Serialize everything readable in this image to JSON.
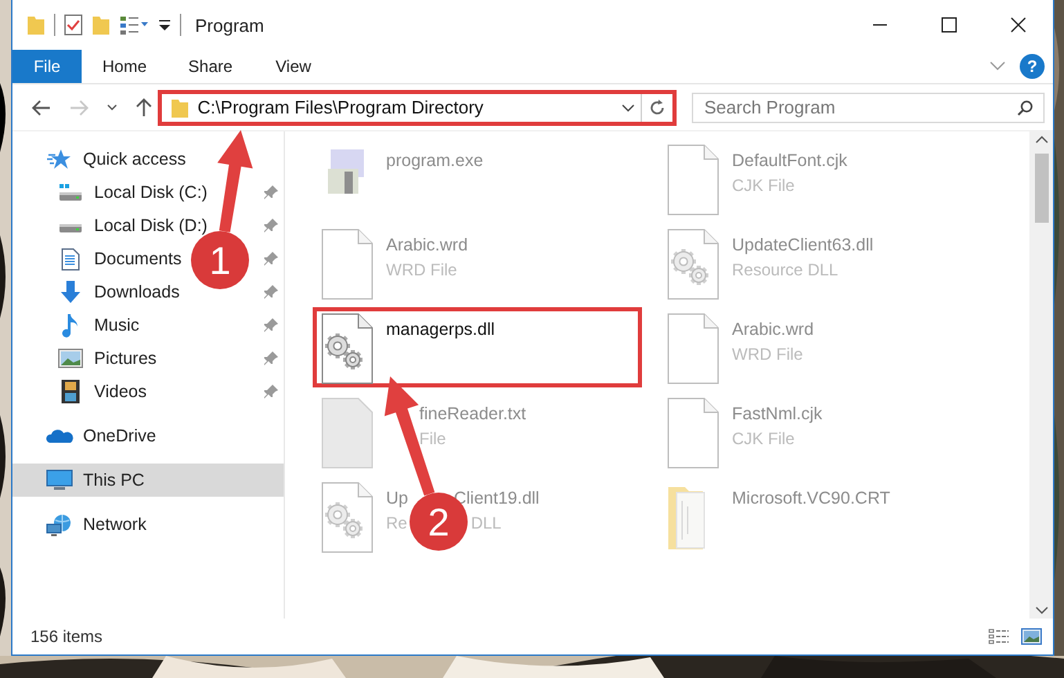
{
  "window": {
    "title": "Program"
  },
  "ribbon_tabs": [
    {
      "label": "File",
      "selected": true
    },
    {
      "label": "Home",
      "selected": false
    },
    {
      "label": "Share",
      "selected": false
    },
    {
      "label": "View",
      "selected": false
    }
  ],
  "help_button": {
    "label": "?"
  },
  "address": {
    "path": "C:\\Program Files\\Program Directory",
    "highlighted": true
  },
  "search": {
    "placeholder": "Search Program"
  },
  "sidebar": {
    "items": [
      {
        "label": "Quick access",
        "kind": "star",
        "selected": false,
        "children": [
          {
            "label": "Local Disk (C:)",
            "kind": "system-drive",
            "pinned": true,
            "selected": false
          },
          {
            "label": "Local Disk (D:)",
            "kind": "drive",
            "pinned": true,
            "selected": false
          },
          {
            "label": "Documents",
            "kind": "documents",
            "pinned": true,
            "selected": false
          },
          {
            "label": "Downloads",
            "kind": "downloads",
            "pinned": true,
            "selected": false
          },
          {
            "label": "Music",
            "kind": "music",
            "pinned": true,
            "selected": false
          },
          {
            "label": "Pictures",
            "kind": "pictures",
            "pinned": true,
            "selected": false
          },
          {
            "label": "Videos",
            "kind": "videos",
            "pinned": true,
            "selected": false
          }
        ]
      },
      {
        "label": "OneDrive",
        "kind": "cloud",
        "selected": false
      },
      {
        "label": "This PC",
        "kind": "computer",
        "selected": true
      },
      {
        "label": "Network",
        "kind": "network",
        "selected": false
      }
    ]
  },
  "files": [
    {
      "name_parts": [
        "program.exe"
      ],
      "kind": "program",
      "faded": true,
      "highlighted": false
    },
    {
      "name_parts": [
        "DefaultFont.cjk"
      ],
      "type_parts": [
        "CJK File"
      ],
      "kind": "document",
      "faded": true,
      "highlighted": false
    },
    {
      "name_parts": [
        "Arabic.wrd"
      ],
      "type_parts": [
        "WRD File"
      ],
      "kind": "document",
      "faded": true,
      "highlighted": false
    },
    {
      "name_parts": [
        "UpdateClient63.dll"
      ],
      "type_parts": [
        "Resource DLL"
      ],
      "kind": "library",
      "faded": true,
      "highlighted": false
    },
    {
      "name_parts": [
        "managerps.dll"
      ],
      "kind": "library",
      "faded": false,
      "highlighted": true
    },
    {
      "name_parts": [
        "Arabic.wrd"
      ],
      "type_parts": [
        "WRD File"
      ],
      "kind": "document",
      "faded": true,
      "highlighted": false
    },
    {
      "name_parts": [
        "fineReader.txt"
      ],
      "type_parts": [
        "File"
      ],
      "kind": "text",
      "faded": true,
      "highlighted": false,
      "start_covered": true
    },
    {
      "name_parts": [
        "FastNml.cjk"
      ],
      "type_parts": [
        "CJK File"
      ],
      "kind": "document",
      "faded": true,
      "highlighted": false
    },
    {
      "name_parts": [
        "Up",
        "Client19.dll"
      ],
      "type_parts": [
        "Re",
        "DLL"
      ],
      "kind": "library",
      "faded": true,
      "highlighted": false
    },
    {
      "name_parts": [
        "Microsoft.VC90.CRT"
      ],
      "kind": "folder",
      "faded": true,
      "highlighted": false
    }
  ],
  "status_bar": {
    "item_count": "156 items"
  },
  "annotations": [
    {
      "label": "1"
    },
    {
      "label": "2"
    }
  ]
}
